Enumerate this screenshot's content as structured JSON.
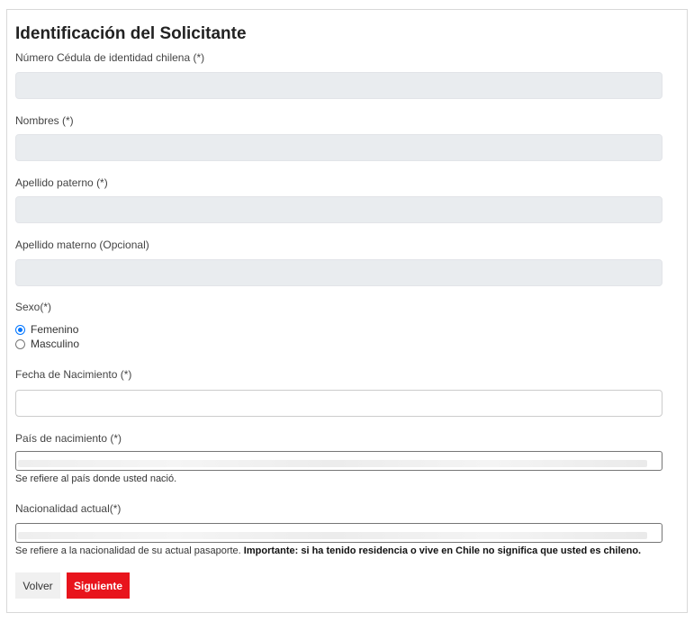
{
  "form": {
    "title": "Identificación del Solicitante",
    "cedula_label": "Número Cédula de identidad chilena (*)",
    "nombres_label": "Nombres (*)",
    "apellido_paterno_label": "Apellido paterno (*)",
    "apellido_materno_label": "Apellido materno (Opcional)",
    "sexo_label": "Sexo(*)",
    "sexo_options": [
      {
        "label": "Femenino",
        "checked": true
      },
      {
        "label": "Masculino",
        "checked": false
      }
    ],
    "fecha_label": "Fecha de Nacimiento (*)",
    "pais_label": "País de nacimiento (*)",
    "pais_help": "Se refiere al país donde usted nació.",
    "nacionalidad_label": "Nacionalidad actual(*)",
    "nacionalidad_help": "Se refiere a la nacionalidad de su actual pasaporte.",
    "nacionalidad_help_bold": "Importante: si ha tenido residencia o vive en Chile no significa que usted es chileno."
  },
  "buttons": {
    "back": "Volver",
    "next": "Siguiente"
  },
  "colors": {
    "accent_red": "#e8141c",
    "radio_blue": "#0075ff",
    "disabled_field": "#e9ecef"
  }
}
